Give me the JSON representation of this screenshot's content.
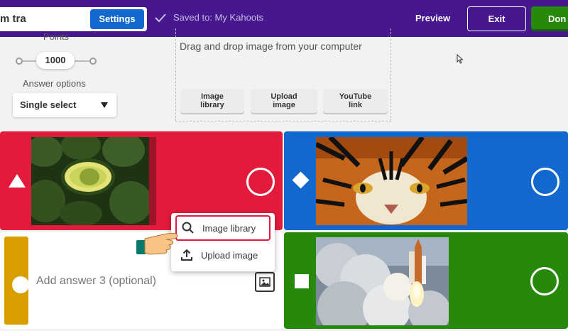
{
  "header": {
    "title_fragment": "m tra",
    "settings_label": "Settings",
    "saved_text": "Saved to: My Kahoots",
    "preview_label": "Preview",
    "exit_label": "Exit",
    "done_label": "Don"
  },
  "settings_panel": {
    "points_label": "Points",
    "points_value": "1000",
    "answer_options_label": "Answer options",
    "answer_options_value": "Single select"
  },
  "media": {
    "drop_text": "Drag and drop image from your computer",
    "buttons": [
      "Image library",
      "Upload image",
      "YouTube link"
    ]
  },
  "answers": {
    "answer3_placeholder": "Add answer 3 (optional)",
    "colors": {
      "red": "#e21b3c",
      "blue": "#1368ce",
      "yellow": "#d89e00",
      "green": "#26890c"
    }
  },
  "popup": {
    "items": [
      {
        "label": "Image library",
        "icon": "search-icon"
      },
      {
        "label": "Upload image",
        "icon": "upload-icon"
      }
    ]
  },
  "colors": {
    "topbar": "#46178f",
    "settings_button": "#1368ce",
    "done_button": "#26890c"
  }
}
